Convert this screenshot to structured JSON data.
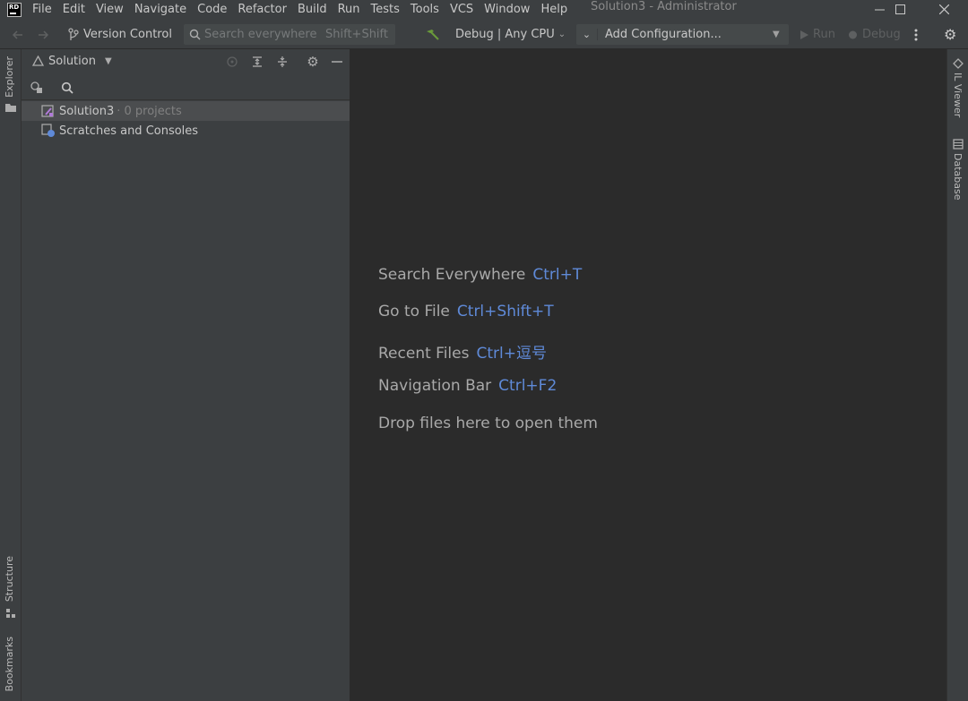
{
  "window": {
    "logo_text": "RD",
    "title": "Solution3 - Administrator",
    "minimize_icon": "minimize-icon",
    "maximize_icon": "maximize-icon",
    "close_icon": "close-icon"
  },
  "menu": {
    "items": [
      "File",
      "Edit",
      "View",
      "Navigate",
      "Code",
      "Refactor",
      "Build",
      "Run",
      "Tests",
      "Tools",
      "VCS",
      "Window",
      "Help"
    ]
  },
  "toolbar": {
    "version_control_label": "Version Control",
    "search_placeholder": "Search everywhere",
    "search_shortcut": "Shift+Shift",
    "build_config_label": "Debug | Any CPU",
    "run_config_label": "Add Configuration...",
    "run_label": "Run",
    "debug_label": "Debug"
  },
  "left_strip": {
    "explorer_label": "Explorer",
    "structure_label": "Structure",
    "bookmarks_label": "Bookmarks"
  },
  "right_strip": {
    "il_viewer_label": "IL Viewer",
    "database_label": "Database"
  },
  "explorer": {
    "view_label": "Solution",
    "tree": [
      {
        "label": "Solution3",
        "sub": "· 0 projects",
        "selected": true,
        "icon": "solution-icon"
      },
      {
        "label": "Scratches and Consoles",
        "sub": "",
        "selected": false,
        "icon": "scratches-icon"
      }
    ]
  },
  "editor_hints": [
    {
      "label": "Search Everywhere",
      "shortcut": "Ctrl+T"
    },
    {
      "label": "Go to File",
      "shortcut": "Ctrl+Shift+T"
    },
    {
      "label": "Recent Files",
      "shortcut": "Ctrl+逗号"
    },
    {
      "label": "Navigation Bar",
      "shortcut": "Ctrl+F2"
    },
    {
      "label": "Drop files here to open them",
      "shortcut": ""
    }
  ],
  "colors": {
    "background": "#2b2b2b",
    "chrome": "#3c3f41",
    "shortcut_accent": "#5f8ad8",
    "build_icon": "#6a9a3a"
  }
}
